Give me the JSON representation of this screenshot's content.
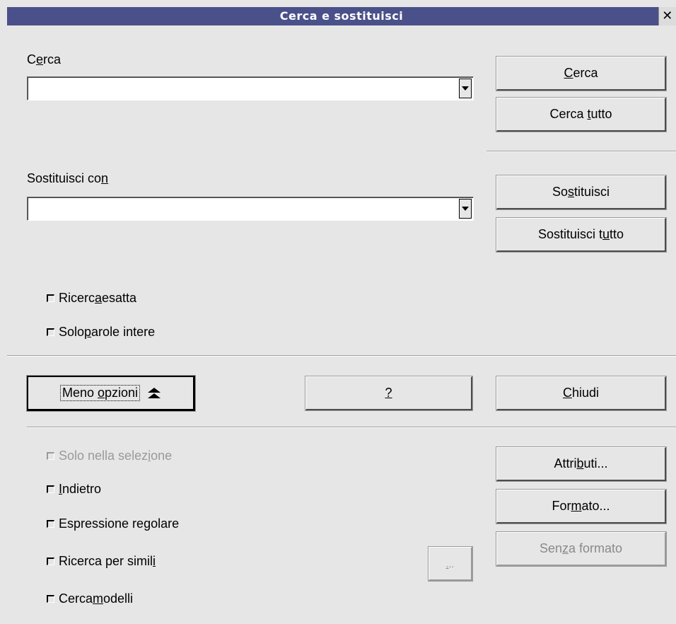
{
  "window": {
    "title": "Cerca e sostituisci",
    "close_glyph": "✕"
  },
  "search": {
    "label_pre": "C",
    "label_u": "e",
    "label_post": "rca",
    "value": ""
  },
  "replace": {
    "label_pre": "Sostituisci co",
    "label_u": "n",
    "label_post": "",
    "value": ""
  },
  "buttons": {
    "cerca": {
      "pre": "",
      "u": "C",
      "post": "erca"
    },
    "cerca_tutto": {
      "pre": "Cerca ",
      "u": "t",
      "post": "utto"
    },
    "sostituisci": {
      "pre": "So",
      "u": "s",
      "post": "tituisci"
    },
    "sostituisci_tutto": {
      "pre": "Sostituisci t",
      "u": "u",
      "post": "tto"
    },
    "meno_opzioni": {
      "pre": "Meno ",
      "u": "o",
      "post": "pzioni"
    },
    "help": {
      "pre": "",
      "u": "?",
      "post": ""
    },
    "chiudi": {
      "pre": "",
      "u": "C",
      "post": "hiudi"
    },
    "attributi": {
      "pre": "Attri",
      "u": "b",
      "post": "uti..."
    },
    "formato": {
      "pre": "For",
      "u": "m",
      "post": "ato..."
    },
    "senza_formato": {
      "pre": "Sen",
      "u": "z",
      "post": "a formato"
    },
    "similarity_settings": {
      "pre": "",
      "u": ".",
      "post": ".."
    }
  },
  "checkboxes": {
    "ricerca_esatta": {
      "pre": "Ricerc",
      "u": "a",
      "post": " esatta",
      "checked": false
    },
    "solo_parole_intere": {
      "pre": "Solo ",
      "u": "p",
      "post": "arole intere",
      "checked": false
    },
    "solo_selezione": {
      "pre": "Solo nella selez",
      "u": "i",
      "post": "one",
      "checked": false,
      "disabled": true
    },
    "indietro": {
      "pre": "",
      "u": "I",
      "post": "ndietro",
      "checked": false
    },
    "espressione_regolare": {
      "pre": "Espressione re",
      "u": "g",
      "post": "olare",
      "checked": false
    },
    "ricerca_simili": {
      "pre": "Ricerca per simil",
      "u": "i",
      "post": "",
      "checked": false
    },
    "cerca_modelli": {
      "pre": "Cerca ",
      "u": "m",
      "post": "odelli",
      "checked": false
    }
  }
}
